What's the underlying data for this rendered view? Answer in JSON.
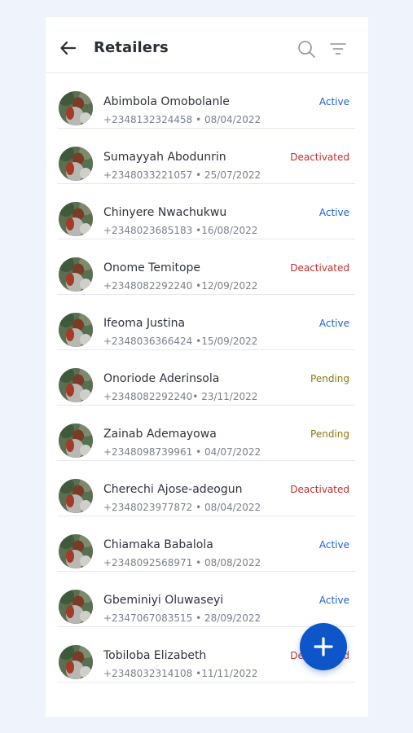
{
  "header": {
    "title": "Retailers"
  },
  "icons": {
    "back": "arrow-left-icon",
    "search": "search-icon",
    "filter": "filter-icon",
    "add": "plus-icon"
  },
  "colors": {
    "active": "#1f5fd0",
    "deactivated": "#c0302c",
    "pending": "#8a7b12",
    "fab": "#0e55c9"
  },
  "retailers": [
    {
      "name": "Abimbola Omobolanle",
      "meta": "+2348132324458 • 08/04/2022",
      "status": "Active"
    },
    {
      "name": "Sumayyah Abodunrin",
      "meta": "+2348033221057 • 25/07/2022",
      "status": "Deactivated"
    },
    {
      "name": "Chinyere Nwachukwu",
      "meta": "+2348023685183 •16/08/2022",
      "status": "Active"
    },
    {
      "name": "Onome Temitope",
      "meta": "+2348082292240 •12/09/2022",
      "status": "Deactivated"
    },
    {
      "name": "Ifeoma Justina",
      "meta": "+2348036366424 •15/09/2022",
      "status": "Active"
    },
    {
      "name": "Onoriode Aderinsola",
      "meta": "+2348082292240• 23/11/2022",
      "status": "Pending"
    },
    {
      "name": "Zainab Ademayowa",
      "meta": "+2348098739961 • 04/07/2022",
      "status": "Pending"
    },
    {
      "name": "Cherechi Ajose-adeogun",
      "meta": "+2348023977872 • 08/04/2022",
      "status": "Deactivated"
    },
    {
      "name": "Chiamaka Babalola",
      "meta": "+2348092568971 • 08/08/2022",
      "status": "Active"
    },
    {
      "name": "Gbeminiyi Oluwaseyi",
      "meta": "+2347067083515 • 28/09/2022",
      "status": "Active"
    },
    {
      "name": "Tobiloba Elizabeth",
      "meta": "+2348032314108 •11/11/2022",
      "status": "Deactivated"
    }
  ]
}
